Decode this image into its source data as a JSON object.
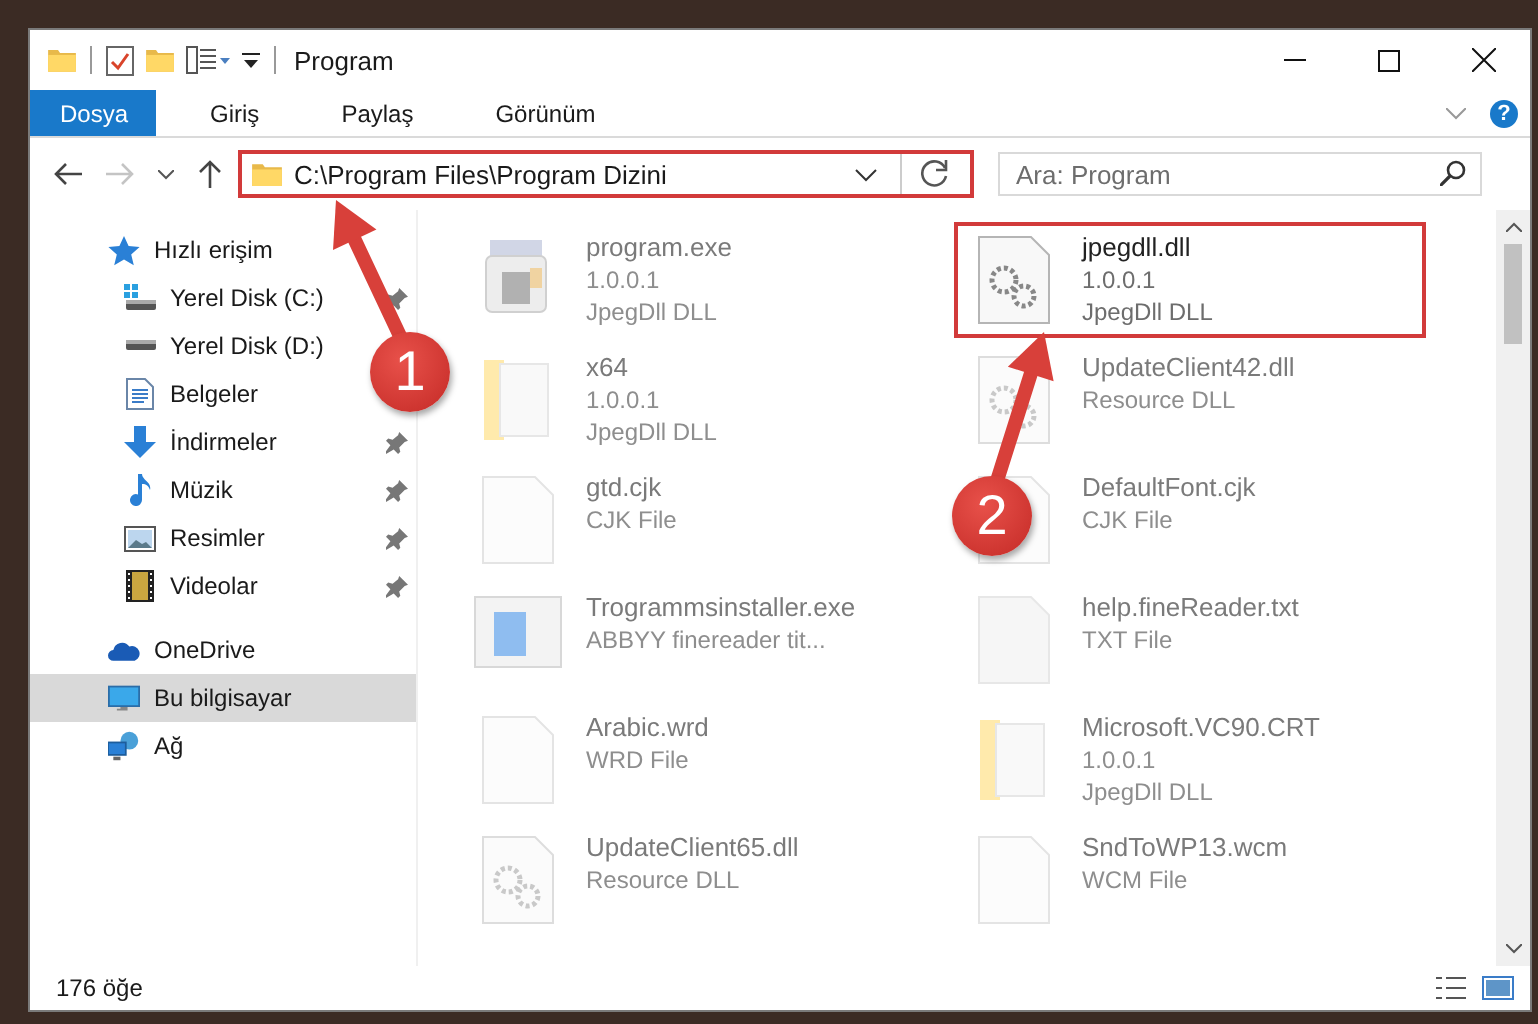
{
  "window": {
    "title": "Program"
  },
  "ribbon": {
    "tabs": [
      {
        "label": "Dosya",
        "selected": true
      },
      {
        "label": "Giriş",
        "selected": false
      },
      {
        "label": "Paylaş",
        "selected": false
      },
      {
        "label": "Görünüm",
        "selected": false
      }
    ],
    "help": "?"
  },
  "address": {
    "path": "C:\\Program Files\\Program Dizini",
    "highlighted": true
  },
  "search": {
    "placeholder": "Ara: Program"
  },
  "sidebar": {
    "items": [
      {
        "label": "Hızlı erişim",
        "kind": "star",
        "selected": false,
        "children": [
          {
            "label": "Yerel Disk (C:)",
            "kind": "disk-c",
            "pinned": true,
            "selected": false
          },
          {
            "label": "Yerel Disk (D:)",
            "kind": "disk",
            "pinned": false,
            "selected": false
          },
          {
            "label": "Belgeler",
            "kind": "docs",
            "pinned": false,
            "selected": false
          },
          {
            "label": "İndirmeler",
            "kind": "download",
            "pinned": true,
            "selected": false
          },
          {
            "label": "Müzik",
            "kind": "music",
            "pinned": true,
            "selected": false
          },
          {
            "label": "Resimler",
            "kind": "pictures",
            "pinned": true,
            "selected": false
          },
          {
            "label": "Videolar",
            "kind": "video",
            "pinned": true,
            "selected": false
          }
        ]
      },
      {
        "label": "OneDrive",
        "kind": "cloud",
        "selected": false
      },
      {
        "label": "Bu bilgisayar",
        "kind": "computer",
        "selected": true
      },
      {
        "label": "Ağ",
        "kind": "network",
        "selected": false
      }
    ]
  },
  "files": [
    {
      "name": "program.exe",
      "details": [
        "1.0.0.1",
        "JpegDll DLL"
      ],
      "kind": "exe",
      "highlighted": false
    },
    {
      "name": "jpegdll.dll",
      "details": [
        "1.0.0.1",
        "JpegDll DLL"
      ],
      "kind": "dll",
      "highlighted": true
    },
    {
      "name": "x64",
      "details": [
        "1.0.0.1",
        "JpegDll DLL"
      ],
      "kind": "folder",
      "highlighted": false
    },
    {
      "name": "UpdateClient42.dll",
      "details": [
        "Resource DLL"
      ],
      "kind": "dll",
      "highlighted": false
    },
    {
      "name": "gtd.cjk",
      "details": [
        "CJK File"
      ],
      "kind": "file",
      "highlighted": false
    },
    {
      "name": "DefaultFont.cjk",
      "details": [
        "CJK File"
      ],
      "kind": "file",
      "highlighted": false
    },
    {
      "name": "Trogrammsinstaller.exe",
      "details": [
        "ABBYY finereader tit..."
      ],
      "kind": "installer",
      "highlighted": false
    },
    {
      "name": "help.fineReader.txt",
      "details": [
        "TXT File"
      ],
      "kind": "text",
      "highlighted": false
    },
    {
      "name": "Arabic.wrd",
      "details": [
        "WRD File"
      ],
      "kind": "file",
      "highlighted": false
    },
    {
      "name": "Microsoft.VC90.CRT",
      "details": [
        "1.0.0.1",
        "JpegDll DLL"
      ],
      "kind": "folder",
      "highlighted": false
    },
    {
      "name": "UpdateClient65.dll",
      "details": [
        "Resource DLL"
      ],
      "kind": "dll",
      "highlighted": false
    },
    {
      "name": "SndToWP13.wcm",
      "details": [
        "WCM File"
      ],
      "kind": "file",
      "highlighted": false
    }
  ],
  "status_bar": {
    "count": "176 öğe"
  },
  "callouts": [
    {
      "label": "1"
    },
    {
      "label": "2"
    }
  ]
}
